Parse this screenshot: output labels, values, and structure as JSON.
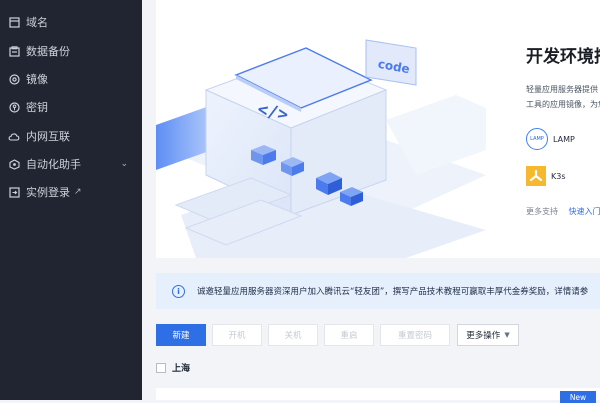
{
  "sidebar": {
    "items": [
      {
        "label": "域名",
        "icon": "domain-icon"
      },
      {
        "label": "数据备份",
        "icon": "backup-icon"
      },
      {
        "label": "镜像",
        "icon": "image-icon"
      },
      {
        "label": "密钥",
        "icon": "key-icon"
      },
      {
        "label": "内网互联",
        "icon": "cloud-connect-icon"
      },
      {
        "label": "自动化助手",
        "icon": "automation-icon"
      },
      {
        "label": "实例登录",
        "icon": "login-icon"
      }
    ]
  },
  "banner": {
    "code_tag": "code",
    "code_symbol": "</>",
    "title": "开发环境搭",
    "desc_line1": "轻量应用服务器提供 L",
    "desc_line2": "工具的应用镜像，为您",
    "images": [
      {
        "logo_text": "LAMP",
        "label": "LAMP"
      },
      {
        "label": "K3s"
      }
    ],
    "more_label": "更多支持",
    "quick_start_label": "快速入门"
  },
  "notice": {
    "text": "诚邀轻量应用服务器资深用户加入腾讯云“轻友团”，撰写产品技术教程可赢取丰厚代金券奖励，详情请参"
  },
  "toolbar": {
    "new_label": "新建",
    "power_on_label": "开机",
    "power_off_label": "关机",
    "restart_label": "重启",
    "reset_password_label": "重置密码",
    "more_actions_label": "更多操作"
  },
  "region": {
    "label": "上海"
  },
  "card": {
    "badge": "New"
  },
  "colors": {
    "sidebar_bg": "#202531",
    "accent": "#2f6fe5",
    "notice_bg": "#e6f0fd"
  }
}
